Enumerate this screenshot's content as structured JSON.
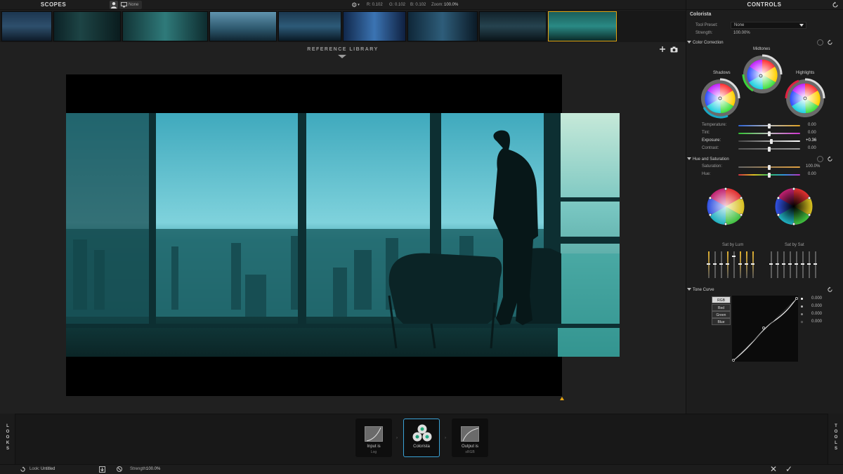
{
  "app": {
    "scopes_title": "SCOPES",
    "controls_title": "CONTROLS"
  },
  "topbar": {
    "monitor_label": "None",
    "r": "R: 0.102",
    "g": "G: 0.102",
    "b": "B: 0.102",
    "zoom_label": "Zoom:",
    "zoom": "100.0%"
  },
  "reference": {
    "title": "REFERENCE LIBRARY"
  },
  "controls": {
    "tool_name": "Colorista",
    "tool_preset_label": "Tool Preset:",
    "tool_preset_value": "None",
    "strength_label": "Strength:",
    "strength_value": "100.00%",
    "color_correction": "Color Correction",
    "wheels": {
      "shadows": "Shadows",
      "midtones": "Midtones",
      "highlights": "Highlights"
    },
    "sliders": [
      {
        "label": "Temperature:",
        "value": "0.00",
        "level": 0.5
      },
      {
        "label": "Tint:",
        "value": "0.00",
        "level": 0.5
      },
      {
        "label": "Exposure:",
        "value": "+0.36",
        "level": 0.53
      },
      {
        "label": "Contrast:",
        "value": "0.00",
        "level": 0.5
      }
    ],
    "hue_sat": "Hue and Saturation",
    "hs_sliders": [
      {
        "label": "Saturation:",
        "value": "100.0%",
        "level": 0.5
      },
      {
        "label": "Hue:",
        "value": "0.00",
        "level": 0.5
      }
    ],
    "sat_by_lum": "Sat by Lum",
    "sat_by_sat": "Sat by Sat",
    "tone_curve": "Tone Curve",
    "curve_channels": [
      "RGB",
      "Red",
      "Green",
      "Blue"
    ],
    "curve_values": [
      "0.000",
      "0.000",
      "0.000",
      "0.000"
    ]
  },
  "pipeline": [
    {
      "title": "Input is",
      "sub": "Log"
    },
    {
      "title": "Colorista",
      "sub": ""
    },
    {
      "title": "Output is",
      "sub": "sRGB"
    }
  ],
  "side_tabs": {
    "looks": "LOOKS",
    "tools": "TOOLS"
  },
  "status": {
    "look_label": "Look:",
    "look_value": "Untitled",
    "strength_label": "Strength:",
    "strength_value": "100.0%"
  },
  "colors": {
    "accent": "#e3a313",
    "node_active": "#3aa2d6",
    "teal": "#2aa7a7"
  }
}
